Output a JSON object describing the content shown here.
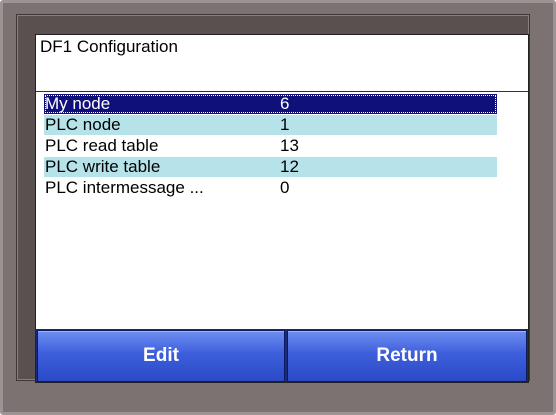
{
  "screen": {
    "title": "DF1 Configuration"
  },
  "list": {
    "rows": [
      {
        "name": "My node",
        "value": "6",
        "selected": true
      },
      {
        "name": "PLC node",
        "value": "1"
      },
      {
        "name": "PLC read table",
        "value": "13"
      },
      {
        "name": "PLC write table",
        "value": "12"
      },
      {
        "name": "PLC intermessage ...",
        "value": "0"
      }
    ]
  },
  "buttons": {
    "edit_label": "Edit",
    "return_label": "Return"
  },
  "colors": {
    "bezel": "#7d7272",
    "selected_row": "#10107a",
    "alt_row": "#b6e3ea",
    "button": "#3e5fdc"
  }
}
